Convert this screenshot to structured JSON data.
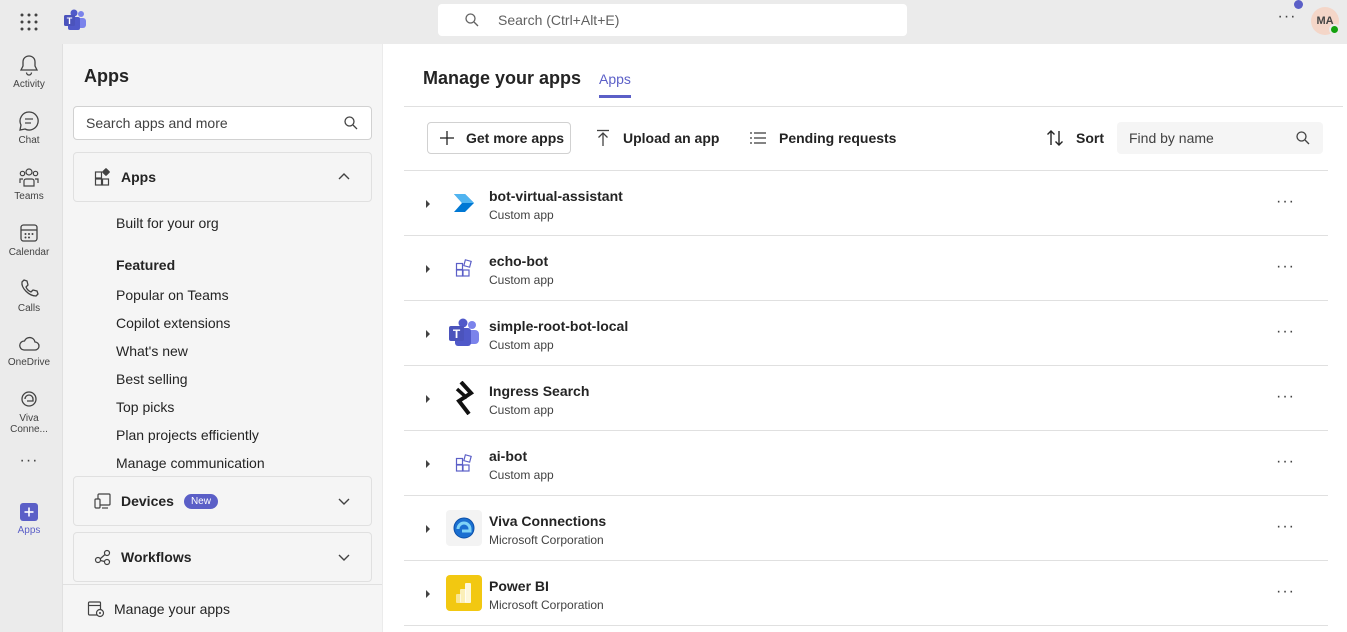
{
  "topbar": {
    "search_placeholder": "Search (Ctrl+Alt+E)",
    "more": "···",
    "avatar_initials": "MA"
  },
  "rail": [
    {
      "label": "Activity",
      "icon": "bell-icon"
    },
    {
      "label": "Chat",
      "icon": "chat-icon"
    },
    {
      "label": "Teams",
      "icon": "teams-icon"
    },
    {
      "label": "Calendar",
      "icon": "calendar-icon"
    },
    {
      "label": "Calls",
      "icon": "phone-icon"
    },
    {
      "label": "OneDrive",
      "icon": "cloud-icon"
    },
    {
      "label": "Viva Conne...",
      "icon": "viva-icon"
    },
    {
      "label": "···",
      "icon": "more-icon"
    },
    {
      "label": "Apps",
      "icon": "apps-plus-icon"
    }
  ],
  "panel": {
    "title": "Apps",
    "search_placeholder": "Search apps and more",
    "apps_section": "Apps",
    "links": [
      {
        "label": "Built for your org",
        "bold": false
      },
      {
        "label": "Featured",
        "bold": true
      },
      {
        "label": "Popular on Teams",
        "bold": false
      },
      {
        "label": "Copilot extensions",
        "bold": false
      },
      {
        "label": "What's new",
        "bold": false
      },
      {
        "label": "Best selling",
        "bold": false
      },
      {
        "label": "Top picks",
        "bold": false
      },
      {
        "label": "Plan projects efficiently",
        "bold": false
      },
      {
        "label": "Manage communication",
        "bold": false
      }
    ],
    "devices_section": "Devices",
    "devices_badge": "New",
    "workflows_section": "Workflows",
    "manage_label": "Manage your apps"
  },
  "main": {
    "title": "Manage your apps",
    "tab": "Apps",
    "get_more": "Get more apps",
    "upload": "Upload an app",
    "pending": "Pending requests",
    "sort": "Sort",
    "find_placeholder": "Find by name",
    "apps": [
      {
        "name": "bot-virtual-assistant",
        "sub": "Custom app",
        "icon": "azure-bot-icon"
      },
      {
        "name": "echo-bot",
        "sub": "Custom app",
        "icon": "custom-app-icon"
      },
      {
        "name": "simple-root-bot-local",
        "sub": "Custom app",
        "icon": "teams-app-icon"
      },
      {
        "name": "Ingress Search",
        "sub": "Custom app",
        "icon": "ingress-icon"
      },
      {
        "name": "ai-bot",
        "sub": "Custom app",
        "icon": "custom-app-icon"
      },
      {
        "name": "Viva Connections",
        "sub": "Microsoft Corporation",
        "icon": "viva-connections-icon"
      },
      {
        "name": "Power BI",
        "sub": "Microsoft Corporation",
        "icon": "power-bi-icon"
      }
    ]
  },
  "colors": {
    "accent": "#5b5fc7",
    "powerbi": "#f2c811"
  }
}
